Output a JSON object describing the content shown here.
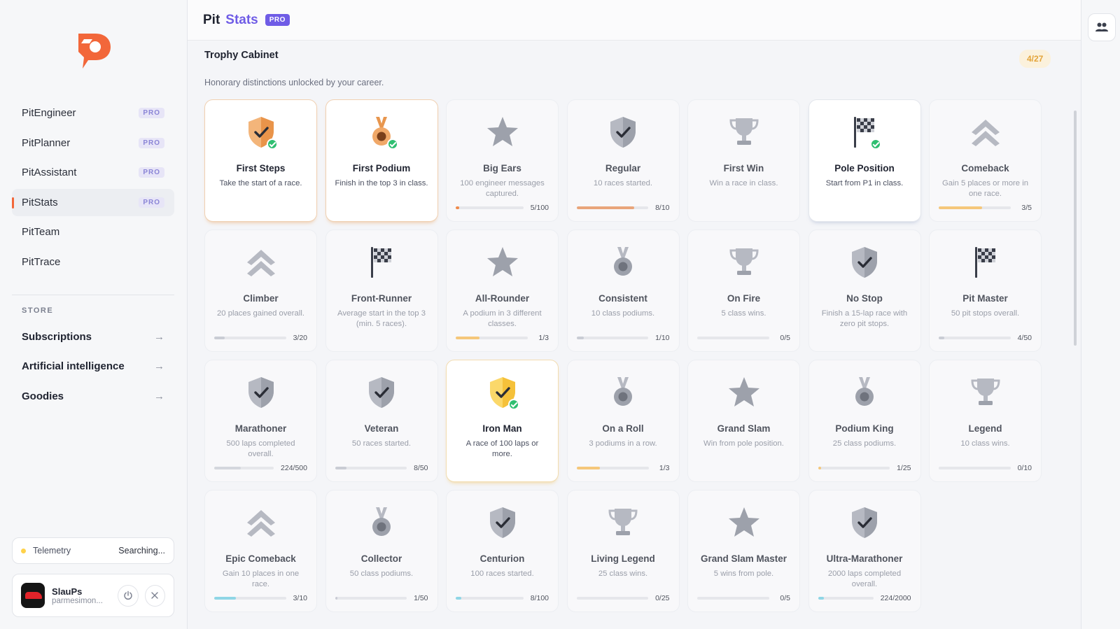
{
  "sidebar": {
    "nav": [
      {
        "label": "PitEngineer",
        "badge": "PRO"
      },
      {
        "label": "PitPlanner",
        "badge": "PRO"
      },
      {
        "label": "PitAssistant",
        "badge": "PRO"
      },
      {
        "label": "PitStats",
        "badge": "PRO",
        "active": true
      },
      {
        "label": "PitTeam"
      },
      {
        "label": "PitTrace"
      }
    ],
    "store_title": "STORE",
    "store": [
      {
        "label": "Subscriptions",
        "arrow": "→"
      },
      {
        "label": "Artificial intelligence",
        "arrow": "→"
      },
      {
        "label": "Goodies",
        "arrow": "→"
      }
    ],
    "telemetry": {
      "label": "Telemetry",
      "status": "Searching..."
    },
    "user": {
      "name": "SlauPs",
      "email": "parmesimon..."
    }
  },
  "header": {
    "brand_left": "Pit",
    "brand_right": "Stats",
    "brand_badge": "PRO"
  },
  "main": {
    "title": "Trophy Cabinet",
    "count": "4/27",
    "subtitle": "Honorary distinctions unlocked by your career.",
    "trophies": [
      {
        "title": "First Steps",
        "desc": "Take the start of a race.",
        "icon": "shield-check-icon",
        "unlocked": true,
        "tier": "bronze"
      },
      {
        "title": "First Podium",
        "desc": "Finish in the top 3 in class.",
        "icon": "medal-icon",
        "unlocked": true,
        "tier": "bronze"
      },
      {
        "title": "Big Ears",
        "desc": "100 engineer messages captured.",
        "icon": "star-icon",
        "progress": "5/100",
        "fraction": 0.05,
        "color": "#f08a4a"
      },
      {
        "title": "Regular",
        "desc": "10 races started.",
        "icon": "shield-check-icon",
        "progress": "8/10",
        "fraction": 0.8,
        "color": "#e9a57a"
      },
      {
        "title": "First Win",
        "desc": "Win a race in class.",
        "icon": "trophy-icon"
      },
      {
        "title": "Pole Position",
        "desc": "Start from P1 in class.",
        "icon": "checkered-flag-icon",
        "unlocked": true,
        "tier": "silver"
      },
      {
        "title": "Comeback",
        "desc": "Gain 5 places or more in one race.",
        "icon": "chevrons-up-icon",
        "progress": "3/5",
        "fraction": 0.6,
        "color": "#f5c77a"
      },
      {
        "title": "Climber",
        "desc": "20 places gained overall.",
        "icon": "chevrons-up-icon",
        "progress": "3/20",
        "fraction": 0.15,
        "color": "#c9ccd4"
      },
      {
        "title": "Front-Runner",
        "desc": "Average start in the top 3 (min. 5 races).",
        "icon": "checkered-flag-icon"
      },
      {
        "title": "All-Rounder",
        "desc": "A podium in 3 different classes.",
        "icon": "star-icon",
        "progress": "1/3",
        "fraction": 0.33,
        "color": "#f5c77a"
      },
      {
        "title": "Consistent",
        "desc": "10 class podiums.",
        "icon": "medal-icon",
        "progress": "1/10",
        "fraction": 0.1,
        "color": "#c9ccd4"
      },
      {
        "title": "On Fire",
        "desc": "5 class wins.",
        "icon": "trophy-icon",
        "progress": "0/5",
        "fraction": 0,
        "color": "#c9ccd4"
      },
      {
        "title": "No Stop",
        "desc": "Finish a 15-lap race with zero pit stops.",
        "icon": "shield-check-icon"
      },
      {
        "title": "Pit Master",
        "desc": "50 pit stops overall.",
        "icon": "checkered-flag-icon",
        "progress": "4/50",
        "fraction": 0.08,
        "color": "#c9ccd4"
      },
      {
        "title": "Marathoner",
        "desc": "500 laps completed overall.",
        "icon": "shield-check-icon",
        "progress": "224/500",
        "fraction": 0.45,
        "color": "#d4d7dd"
      },
      {
        "title": "Veteran",
        "desc": "50 races started.",
        "icon": "shield-check-icon",
        "progress": "8/50",
        "fraction": 0.16,
        "color": "#c9ccd4"
      },
      {
        "title": "Iron Man",
        "desc": "A race of 100 laps or more.",
        "icon": "shield-check-icon",
        "unlocked": true,
        "tier": "gold"
      },
      {
        "title": "On a Roll",
        "desc": "3 podiums in a row.",
        "icon": "medal-icon",
        "progress": "1/3",
        "fraction": 0.33,
        "color": "#f5c77a"
      },
      {
        "title": "Grand Slam",
        "desc": "Win from pole position.",
        "icon": "star-icon"
      },
      {
        "title": "Podium King",
        "desc": "25 class podiums.",
        "icon": "medal-icon",
        "progress": "1/25",
        "fraction": 0.04,
        "color": "#f5c77a"
      },
      {
        "title": "Legend",
        "desc": "10 class wins.",
        "icon": "trophy-icon",
        "progress": "0/10",
        "fraction": 0,
        "color": "#c9ccd4"
      },
      {
        "title": "Epic Comeback",
        "desc": "Gain 10 places in one race.",
        "icon": "chevrons-up-icon",
        "progress": "3/10",
        "fraction": 0.3,
        "color": "#8fd6e6"
      },
      {
        "title": "Collector",
        "desc": "50 class podiums.",
        "icon": "medal-icon",
        "progress": "1/50",
        "fraction": 0.02,
        "color": "#c9ccd4"
      },
      {
        "title": "Centurion",
        "desc": "100 races started.",
        "icon": "shield-check-icon",
        "progress": "8/100",
        "fraction": 0.08,
        "color": "#8fd6e6"
      },
      {
        "title": "Living Legend",
        "desc": "25 class wins.",
        "icon": "trophy-icon",
        "progress": "0/25",
        "fraction": 0,
        "color": "#c9ccd4"
      },
      {
        "title": "Grand Slam Master",
        "desc": "5 wins from pole.",
        "icon": "star-icon",
        "progress": "0/5",
        "fraction": 0,
        "color": "#c9ccd4"
      },
      {
        "title": "Ultra-Marathoner",
        "desc": "2000 laps completed overall.",
        "icon": "shield-check-icon",
        "progress": "224/2000",
        "fraction": 0.11,
        "color": "#8fd6e6"
      }
    ]
  },
  "colors": {
    "accent": "#6f5ce6",
    "orange": "#f2673a",
    "success": "#2fbf71",
    "gold": "#e3a43a"
  }
}
